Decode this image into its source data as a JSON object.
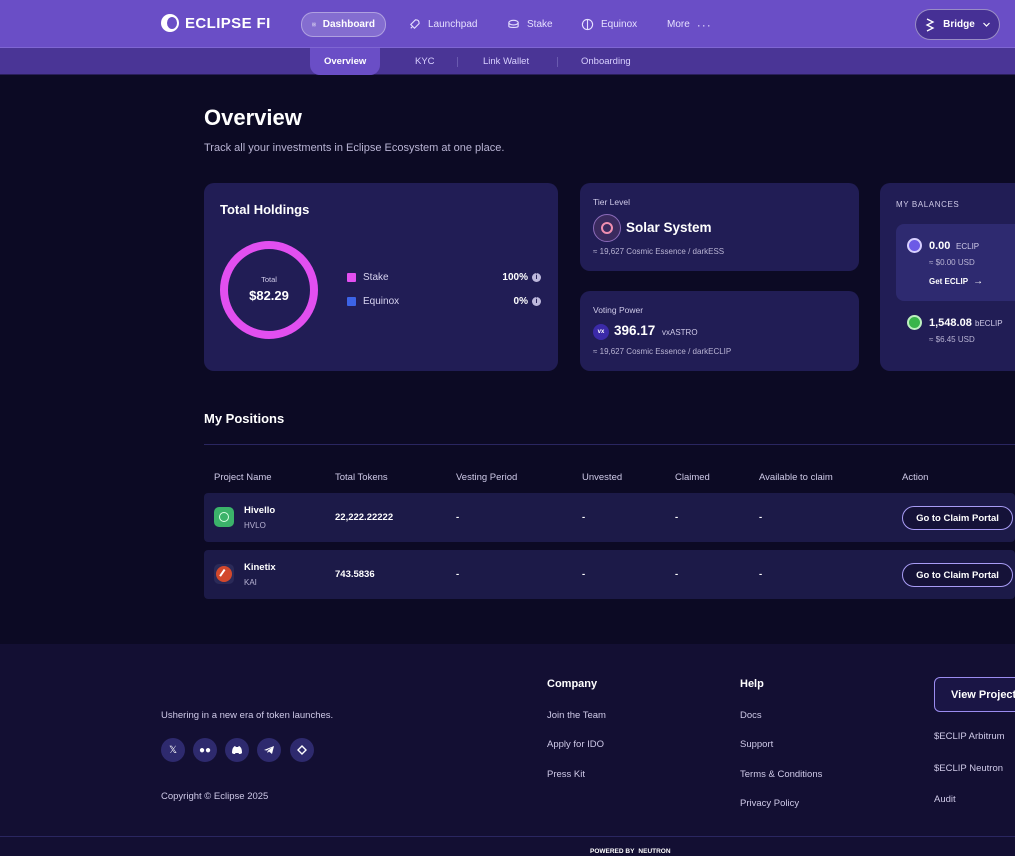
{
  "brand": {
    "name": "ECLIPSE FI"
  },
  "nav": {
    "items": [
      {
        "label": "Dashboard",
        "icon": "grid-icon",
        "active": true
      },
      {
        "label": "Launchpad",
        "icon": "rocket-icon"
      },
      {
        "label": "Stake",
        "icon": "coins-icon"
      },
      {
        "label": "Equinox",
        "icon": "equinox-icon"
      },
      {
        "label": "More",
        "icon": "ellipsis-icon"
      }
    ],
    "bridge_label": "Bridge"
  },
  "subnav": {
    "tabs": [
      "Overview",
      "KYC",
      "Link Wallet",
      "Onboarding"
    ]
  },
  "header": {
    "title": "Overview",
    "subtitle": "Track all your investments in Eclipse Ecosystem at one place."
  },
  "holdings": {
    "title": "Total Holdings",
    "total_label": "Total",
    "total_value": "$82.29",
    "legend": [
      {
        "label": "Stake",
        "value": "100%",
        "color": "#e24ff0"
      },
      {
        "label": "Equinox",
        "value": "0%",
        "color": "#3c63e6"
      }
    ]
  },
  "tier": {
    "label": "Tier Level",
    "name": "Solar System",
    "note": "≈ 19,627 Cosmic Essence / darkESS"
  },
  "voting": {
    "label": "Voting Power",
    "value": "396.17",
    "unit": "vxASTRO",
    "note": "≈ 19,627 Cosmic Essence / darkECLIP"
  },
  "balances": {
    "label": "MY BALANCES",
    "eclip": {
      "value": "0.00",
      "unit": "ECLIP",
      "usd": "≈ $0.00 USD",
      "action": "Get ECLIP"
    },
    "beclip": {
      "value": "1,548.08",
      "unit": "bECLIP",
      "usd": "≈ $6.45 USD"
    }
  },
  "positions": {
    "title": "My Positions",
    "columns": [
      "Project Name",
      "Total Tokens",
      "Vesting Period",
      "Unvested",
      "Claimed",
      "Available to claim",
      "Action"
    ],
    "rows": [
      {
        "name": "Hivello",
        "ticker": "HVLO",
        "tokens": "22,222.22222",
        "vesting": "-",
        "unvested": "-",
        "claimed": "-",
        "available": "-",
        "action": "Go to Claim Portal"
      },
      {
        "name": "Kinetix",
        "ticker": "KAI",
        "tokens": "743.5836",
        "vesting": "-",
        "unvested": "-",
        "claimed": "-",
        "available": "-",
        "action": "Go to Claim Portal"
      }
    ]
  },
  "footer": {
    "tagline": "Ushering in a new era of token launches.",
    "copyright": "Copyright © Eclipse 2025",
    "company": {
      "title": "Company",
      "links": [
        "Join the Team",
        "Apply for IDO",
        "Press Kit"
      ]
    },
    "help": {
      "title": "Help",
      "links": [
        "Docs",
        "Support",
        "Terms & Conditions",
        "Privacy Policy"
      ]
    },
    "view_projects": "View Project",
    "extra_links": [
      "$ECLIP Arbitrum",
      "$ECLIP Neutron",
      "Audit"
    ],
    "powered_by": "POWERED BY",
    "powered_brand": "NEUTRON"
  }
}
